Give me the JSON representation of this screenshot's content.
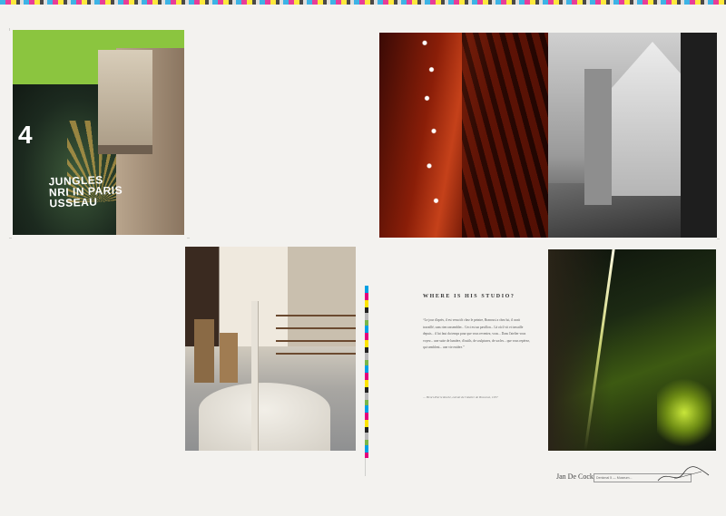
{
  "spread": {
    "photo_museum": {
      "number": "4",
      "exhibition_lines": [
        "JUNGLES",
        "NRI IN PARIS",
        "USSEAU"
      ]
    },
    "text_block": {
      "heading": "WHERE IS HIS STUDIO?",
      "quote": "“Le jour d'après, il est venu tôt chez le peintre, Brancusi a chez lui, il avait travaillé, sans rien rassembler... Ceci est un pavillon... Là où il vit et travaille depuis... il lui faut du temps pour que vous reveniez, vous... Dans l'atelier vous voyez... une suite de lumière, d'outils, de sculptures, de socles... que vous repérez, qui semblent... une vie entière.”",
      "source": "— Henri-Pierre Roché, extrait de l'Atelier de Brancusi, 1957"
    },
    "footer": {
      "author": "Jan De Cock",
      "credit": "Denkmal 5 — Museum..."
    }
  }
}
